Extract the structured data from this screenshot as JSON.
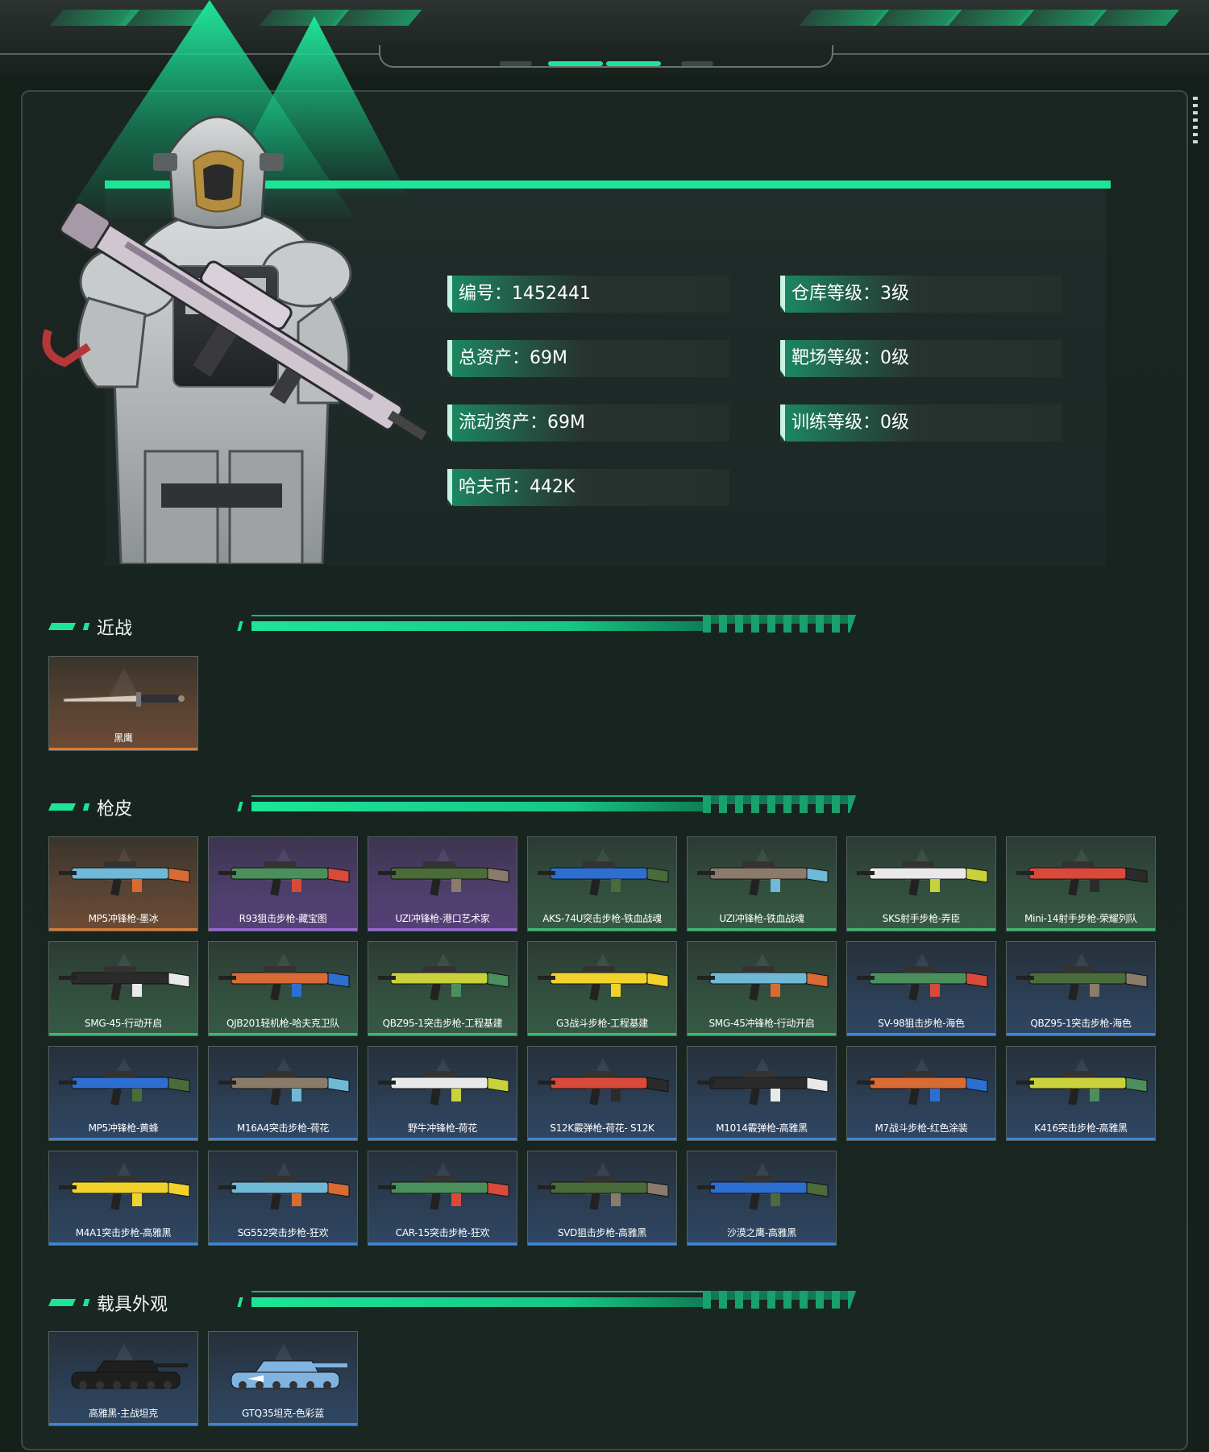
{
  "profile": {
    "stats": [
      {
        "label": "编号",
        "value": "1452441"
      },
      {
        "label": "仓库等级",
        "value": "3级"
      },
      {
        "label": "总资产",
        "value": "69M"
      },
      {
        "label": "靶场等级",
        "value": "0级"
      },
      {
        "label": "流动资产",
        "value": "69M"
      },
      {
        "label": "训练等级",
        "value": "0级"
      },
      {
        "label": "哈夫币",
        "value": "442K"
      }
    ],
    "stat_texts": [
      "编号：1452441",
      "仓库等级：3级",
      "总资产：69M",
      "靶场等级：0级",
      "流动资产：69M",
      "训练等级：0级",
      "哈夫币：442K"
    ]
  },
  "sections": {
    "melee": "近战",
    "skins": "枪皮",
    "vehicles": "载具外观"
  },
  "melee_items": [
    {
      "name": "黑鹰",
      "rarity": "orange"
    }
  ],
  "skin_items": [
    {
      "name": "MP5冲锋枪-墨冰",
      "rarity": "orange"
    },
    {
      "name": "R93狙击步枪-藏宝图",
      "rarity": "purple"
    },
    {
      "name": "UZI冲锋枪-港口艺术家",
      "rarity": "purple"
    },
    {
      "name": "AKS-74U突击步枪-铁血战魂",
      "rarity": "green"
    },
    {
      "name": "UZI冲锋枪-铁血战魂",
      "rarity": "green"
    },
    {
      "name": "SKS射手步枪-弄臣",
      "rarity": "green"
    },
    {
      "name": "Mini-14射手步枪-荣耀列队",
      "rarity": "green"
    },
    {
      "name": "SMG-45-行动开启",
      "rarity": "green"
    },
    {
      "name": "QJB201轻机枪-哈夫克卫队",
      "rarity": "green"
    },
    {
      "name": "QBZ95-1突击步枪-工程基建",
      "rarity": "green"
    },
    {
      "name": "G3战斗步枪-工程基建",
      "rarity": "green"
    },
    {
      "name": "SMG-45冲锋枪-行动开启",
      "rarity": "green"
    },
    {
      "name": "SV-98狙击步枪-海色",
      "rarity": "blue"
    },
    {
      "name": "QBZ95-1突击步枪-海色",
      "rarity": "blue"
    },
    {
      "name": "MP5冲锋枪-黄蜂",
      "rarity": "blue"
    },
    {
      "name": "M16A4突击步枪-荷花",
      "rarity": "blue"
    },
    {
      "name": "野牛冲锋枪-荷花",
      "rarity": "blue"
    },
    {
      "name": "S12K霰弹枪-荷花- S12K",
      "rarity": "blue"
    },
    {
      "name": "M1014霰弹枪-高雅黑",
      "rarity": "blue"
    },
    {
      "name": "M7战斗步枪-红色涂装",
      "rarity": "blue"
    },
    {
      "name": "K416突击步枪-高雅黑",
      "rarity": "blue"
    },
    {
      "name": "M4A1突击步枪-高雅黑",
      "rarity": "blue"
    },
    {
      "name": "SG552突击步枪-狂欢",
      "rarity": "blue"
    },
    {
      "name": "CAR-15突击步枪-狂欢",
      "rarity": "blue"
    },
    {
      "name": "SVD狙击步枪-高雅黑",
      "rarity": "blue"
    },
    {
      "name": "沙漠之鹰-高雅黑",
      "rarity": "blue"
    }
  ],
  "vehicle_items": [
    {
      "name": "高雅黑-主战坦克",
      "rarity": "blue"
    },
    {
      "name": "GTQ35坦克-色彩蓝",
      "rarity": "blue"
    }
  ],
  "colors": {
    "accent": "#1de597",
    "rarity_orange": "#d97b37",
    "rarity_purple": "#9a68d8",
    "rarity_green": "#3fb874",
    "rarity_blue": "#3f86d6"
  },
  "icons": {
    "melee": "knife-icon",
    "skins": "gun-icon",
    "vehicles": "tank-icon"
  }
}
